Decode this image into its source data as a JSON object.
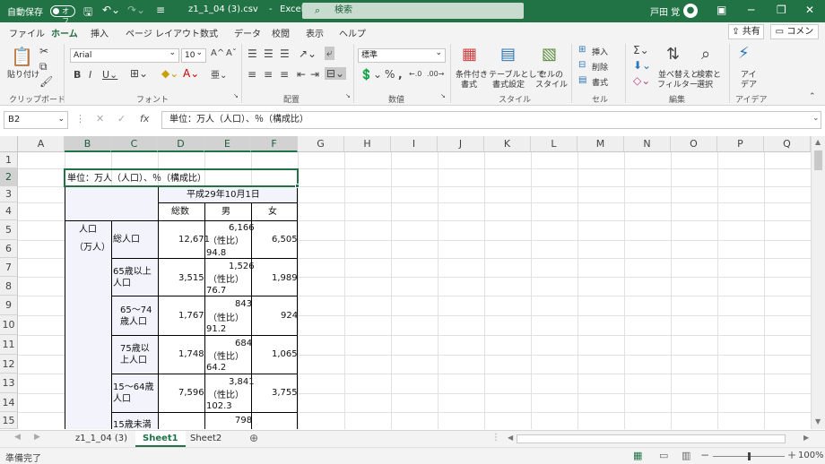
{
  "titlebar": {
    "autosave": "自動保存",
    "toggle": "オフ",
    "filename": "z1_1_04 (3).csv",
    "sep": "-",
    "app": "Excel",
    "search": "検索",
    "user": "戸田 覚"
  },
  "tabs": [
    "ファイル",
    "ホーム",
    "挿入",
    "ページ レイアウト",
    "数式",
    "データ",
    "校閲",
    "表示",
    "ヘルプ"
  ],
  "share": "共有",
  "comment": "コメント",
  "ribbon": {
    "paste": "貼り付け",
    "clipboard": "クリップボード",
    "font_name": "Arial",
    "font_size": "10",
    "font_group": "フォント",
    "align_group": "配置",
    "number_format": "標準",
    "number_group": "数値",
    "cond_format": [
      "条件付き",
      "書式"
    ],
    "table_format": [
      "テーブルとして",
      "書式設定"
    ],
    "cell_style": [
      "セルの",
      "スタイル"
    ],
    "style_group": "スタイル",
    "insert": "挿入",
    "delete": "削除",
    "format": "書式",
    "cells_group": "セル",
    "sort_filter": [
      "並べ替えと",
      "フィルター"
    ],
    "find_select": [
      "検索と",
      "選択"
    ],
    "edit_group": "編集",
    "ideas": [
      "アイ",
      "デア"
    ],
    "ideas_group": "アイデア"
  },
  "formula_bar": {
    "name_box": "B2",
    "formula": "単位：万人（人口）、％（構成比）"
  },
  "columns": [
    "A",
    "B",
    "C",
    "D",
    "E",
    "F",
    "G",
    "H",
    "I",
    "J",
    "K",
    "L",
    "M",
    "N",
    "O",
    "P",
    "Q"
  ],
  "rows": [
    "1",
    "2",
    "3",
    "4",
    "5",
    "6",
    "7",
    "8",
    "9",
    "10",
    "11",
    "12",
    "13",
    "14",
    "15"
  ],
  "cells": {
    "b2": "単位：万人（人口）、％（構成比）",
    "d3": "平成29年10月1日",
    "d4": "総数",
    "e4": "男",
    "f4": "女",
    "b5a": "人口",
    "b5b": "（万人）",
    "r1": {
      "label": "総人口",
      "total": "12,671",
      "male": "6,166",
      "ratio_label": "（性比）",
      "ratio": "94.8",
      "female": "6,505"
    },
    "r2": {
      "label1": "65歳以上",
      "label2": "人口",
      "total": "3,515",
      "male": "1,526",
      "ratio_label": "（性比）",
      "ratio": "76.7",
      "female": "1,989"
    },
    "r3": {
      "label1": "65～74",
      "label2": "歳人口",
      "total": "1,767",
      "male": "843",
      "ratio_label": "（性比）",
      "ratio": "91.2",
      "female": "924"
    },
    "r4": {
      "label1": "75歳以",
      "label2": "上人口",
      "total": "1,748",
      "male": "684",
      "ratio_label": "（性比）",
      "ratio": "64.2",
      "female": "1,065"
    },
    "r5": {
      "label1": "15～64歳",
      "label2": "人口",
      "total": "7,596",
      "male": "3,841",
      "ratio_label": "（性比）",
      "ratio": "102.3",
      "female": "3,755"
    },
    "r6": {
      "label1": "15歳未満",
      "male": "798"
    }
  },
  "sheets": [
    "z1_1_04 (3)",
    "Sheet1",
    "Sheet2"
  ],
  "status": {
    "ready": "準備完了",
    "zoom": "100%"
  }
}
